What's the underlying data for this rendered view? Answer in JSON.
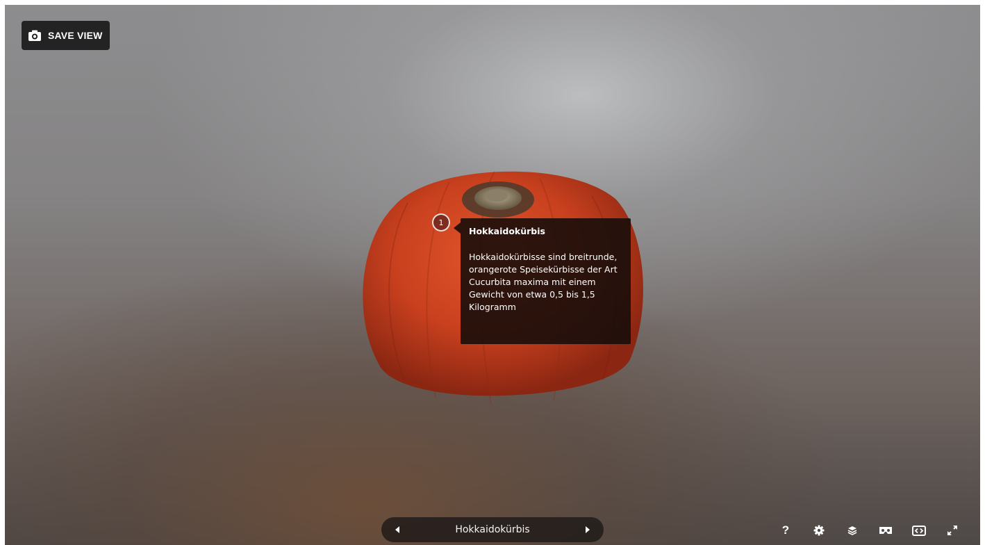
{
  "save_view": {
    "label": "SAVE VIEW",
    "icon": "camera-icon"
  },
  "annotation": {
    "number": "1",
    "title": "Hokkaidokürbis",
    "body": "Hokkaidokürbisse sind breitrunde, orangerote Speisekürbisse der Art Cucurbita maxima mit einem Gewicht von etwa 0,5 bis 1,5 Kilogramm"
  },
  "navigation": {
    "title": "Hokkaidokürbis",
    "prev_icon": "caret-left-icon",
    "next_icon": "caret-right-icon"
  },
  "toolbar": {
    "help_label": "?",
    "icons": [
      "help-icon",
      "gear-icon",
      "layers-icon",
      "vr-headset-icon",
      "embed-icon",
      "fullscreen-icon"
    ]
  },
  "colors": {
    "pumpkin": "#c8401e",
    "panel": "#141414"
  }
}
